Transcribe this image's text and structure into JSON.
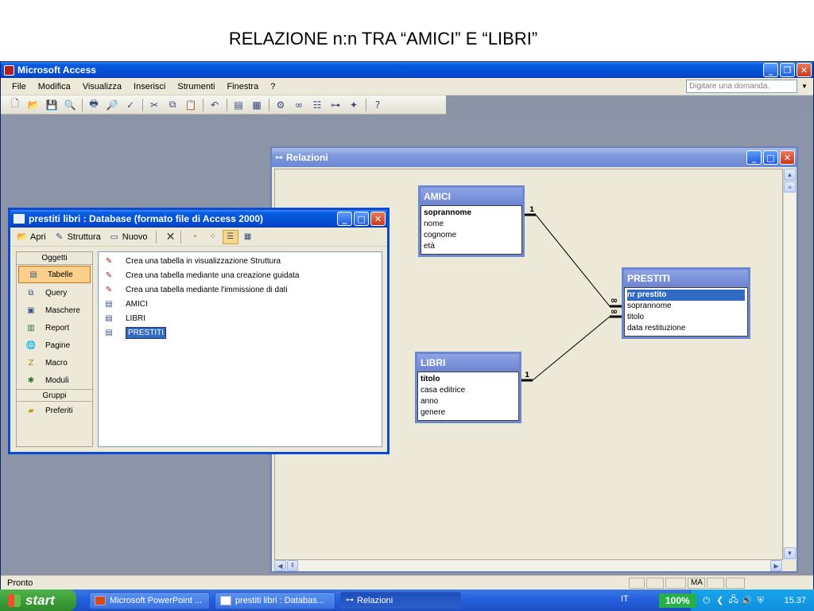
{
  "slide_title": "RELAZIONE n:n TRA “AMICI” E “LIBRI”",
  "app": {
    "title": "Microsoft Access",
    "menu": [
      "File",
      "Modifica",
      "Visualizza",
      "Inserisci",
      "Strumenti",
      "Finestra",
      "?"
    ],
    "help_placeholder": "Digitare una domanda.",
    "status": "Pronto",
    "status_mode": "MA"
  },
  "relations_window": {
    "title": "Relazioni",
    "tables": [
      {
        "name": "AMICI",
        "fields": [
          "soprannome",
          "nome",
          "cognome",
          "età"
        ],
        "key_field": "soprannome"
      },
      {
        "name": "PRESTITI",
        "fields": [
          "nr prestito",
          "soprannome",
          "titolo",
          "data restituzione"
        ],
        "key_field": "nr prestito"
      },
      {
        "name": "LIBRI",
        "fields": [
          "titolo",
          "casa editrice",
          "anno",
          "genere"
        ],
        "key_field": "titolo"
      }
    ],
    "relations": [
      {
        "from": "AMICI",
        "to": "PRESTITI",
        "from_card": "1",
        "to_card": "∞"
      },
      {
        "from": "LIBRI",
        "to": "PRESTITI",
        "from_card": "1",
        "to_card": "∞"
      }
    ]
  },
  "db_window": {
    "title": "prestiti libri : Database (formato file di Access 2000)",
    "toolbar": {
      "open": "Apri",
      "design": "Struttura",
      "new": "Nuovo"
    },
    "objects_header": "Oggetti",
    "objects": [
      "Tabelle",
      "Query",
      "Maschere",
      "Report",
      "Pagine",
      "Macro",
      "Moduli"
    ],
    "selected_object": "Tabelle",
    "groups_header": "Gruppi",
    "groups": [
      "Preferiti"
    ],
    "items": [
      {
        "label": "Crea una tabella in visualizzazione Struttura",
        "kind": "wizard"
      },
      {
        "label": "Crea una tabella mediante una creazione guidata",
        "kind": "wizard"
      },
      {
        "label": "Crea una tabella mediante l'immissione di dati",
        "kind": "wizard"
      },
      {
        "label": "AMICI",
        "kind": "table"
      },
      {
        "label": "LIBRI",
        "kind": "table"
      },
      {
        "label": "PRESTITI",
        "kind": "table",
        "selected": true
      }
    ]
  },
  "taskbar": {
    "start": "start",
    "tasks": [
      "Microsoft PowerPoint ...",
      "prestiti libri : Databas...",
      "Relazioni"
    ],
    "language": "IT",
    "zoom": "100%",
    "clock": "15.37"
  }
}
